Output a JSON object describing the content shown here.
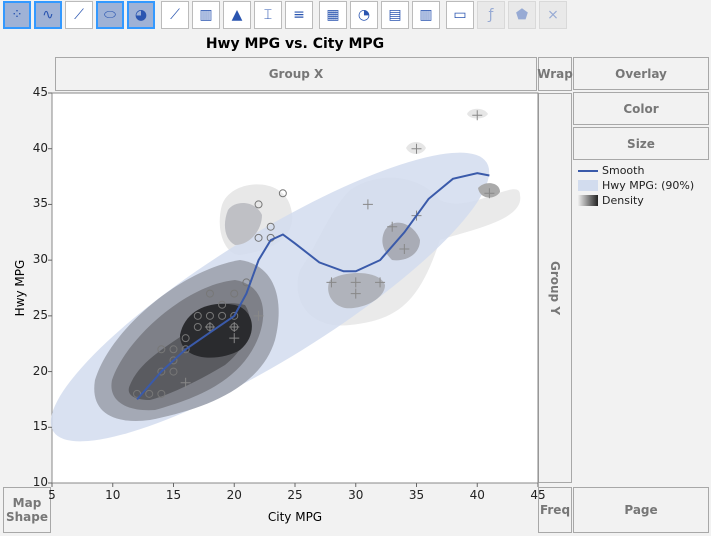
{
  "toolbar": {
    "buttons": [
      {
        "name": "points",
        "sel": true
      },
      {
        "name": "smoother",
        "sel": true
      },
      {
        "name": "line-of-fit",
        "sel": false
      },
      {
        "name": "ellipse",
        "sel": true
      },
      {
        "name": "contour",
        "sel": true
      },
      {
        "name": "line",
        "sel": false
      },
      {
        "name": "bar",
        "sel": false
      },
      {
        "name": "area",
        "sel": false
      },
      {
        "name": "box-plot",
        "sel": false
      },
      {
        "name": "histogram",
        "sel": false
      },
      {
        "name": "heatmap",
        "sel": false
      },
      {
        "name": "pie",
        "sel": false
      },
      {
        "name": "treemap",
        "sel": false
      },
      {
        "name": "mosaic",
        "sel": false
      },
      {
        "name": "caption-box",
        "sel": false
      },
      {
        "name": "formula",
        "sel": false
      },
      {
        "name": "map-shapes",
        "sel": false
      },
      {
        "name": "parallel",
        "sel": false
      }
    ]
  },
  "title": "Hwy MPG vs. City MPG",
  "zones": {
    "group_x": "Group X",
    "wrap": "Wrap",
    "overlay": "Overlay",
    "color": "Color",
    "size": "Size",
    "group_y": "Group Y",
    "map_shape": "Map Shape",
    "freq": "Freq",
    "page": "Page"
  },
  "legend": {
    "smooth": "Smooth",
    "ellipse": "Hwy MPG: (90%)",
    "density": "Density"
  },
  "colors": {
    "smooth": "#3a5aaa",
    "ellipse": "#d2dcee"
  },
  "chart_data": {
    "type": "scatter",
    "title": "Hwy MPG vs. City MPG",
    "xlabel": "City MPG",
    "ylabel": "Hwy MPG",
    "xlim": [
      5,
      45
    ],
    "ylim": [
      10,
      45
    ],
    "xticks": [
      "5",
      "10",
      "15",
      "20",
      "25",
      "30",
      "35",
      "40",
      "45"
    ],
    "yticks": [
      "10",
      "15",
      "20",
      "25",
      "30",
      "35",
      "40",
      "45"
    ],
    "points_circle": [
      [
        12,
        18
      ],
      [
        13,
        18
      ],
      [
        14,
        18
      ],
      [
        14,
        20
      ],
      [
        14,
        22
      ],
      [
        15,
        20
      ],
      [
        15,
        21
      ],
      [
        15,
        22
      ],
      [
        16,
        22
      ],
      [
        16,
        23
      ],
      [
        17,
        24
      ],
      [
        17,
        25
      ],
      [
        18,
        24
      ],
      [
        18,
        25
      ],
      [
        18,
        27
      ],
      [
        19,
        25
      ],
      [
        19,
        26
      ],
      [
        20,
        24
      ],
      [
        20,
        25
      ],
      [
        20,
        27
      ],
      [
        21,
        28
      ],
      [
        22,
        32
      ],
      [
        22,
        35
      ],
      [
        23,
        32
      ],
      [
        23,
        33
      ],
      [
        24,
        36
      ]
    ],
    "points_plus": [
      [
        16,
        19
      ],
      [
        18,
        24
      ],
      [
        20,
        23
      ],
      [
        20,
        24
      ],
      [
        22,
        25
      ],
      [
        28,
        28
      ],
      [
        30,
        27
      ],
      [
        30,
        28
      ],
      [
        32,
        28
      ],
      [
        31,
        35
      ],
      [
        33,
        33
      ],
      [
        34,
        31
      ],
      [
        35,
        34
      ],
      [
        35,
        40
      ],
      [
        40,
        43
      ],
      [
        41,
        36
      ]
    ],
    "smooth": [
      [
        12,
        17.5
      ],
      [
        14,
        20
      ],
      [
        16,
        22
      ],
      [
        18,
        23.5
      ],
      [
        20,
        25
      ],
      [
        21,
        27
      ],
      [
        22,
        30
      ],
      [
        23,
        31.8
      ],
      [
        24,
        32.3
      ],
      [
        25,
        31.5
      ],
      [
        27,
        29.8
      ],
      [
        29,
        29
      ],
      [
        30,
        29
      ],
      [
        32,
        30
      ],
      [
        34,
        32.5
      ],
      [
        36,
        35.5
      ],
      [
        38,
        37.3
      ],
      [
        40,
        37.8
      ],
      [
        41,
        37.6
      ]
    ]
  }
}
